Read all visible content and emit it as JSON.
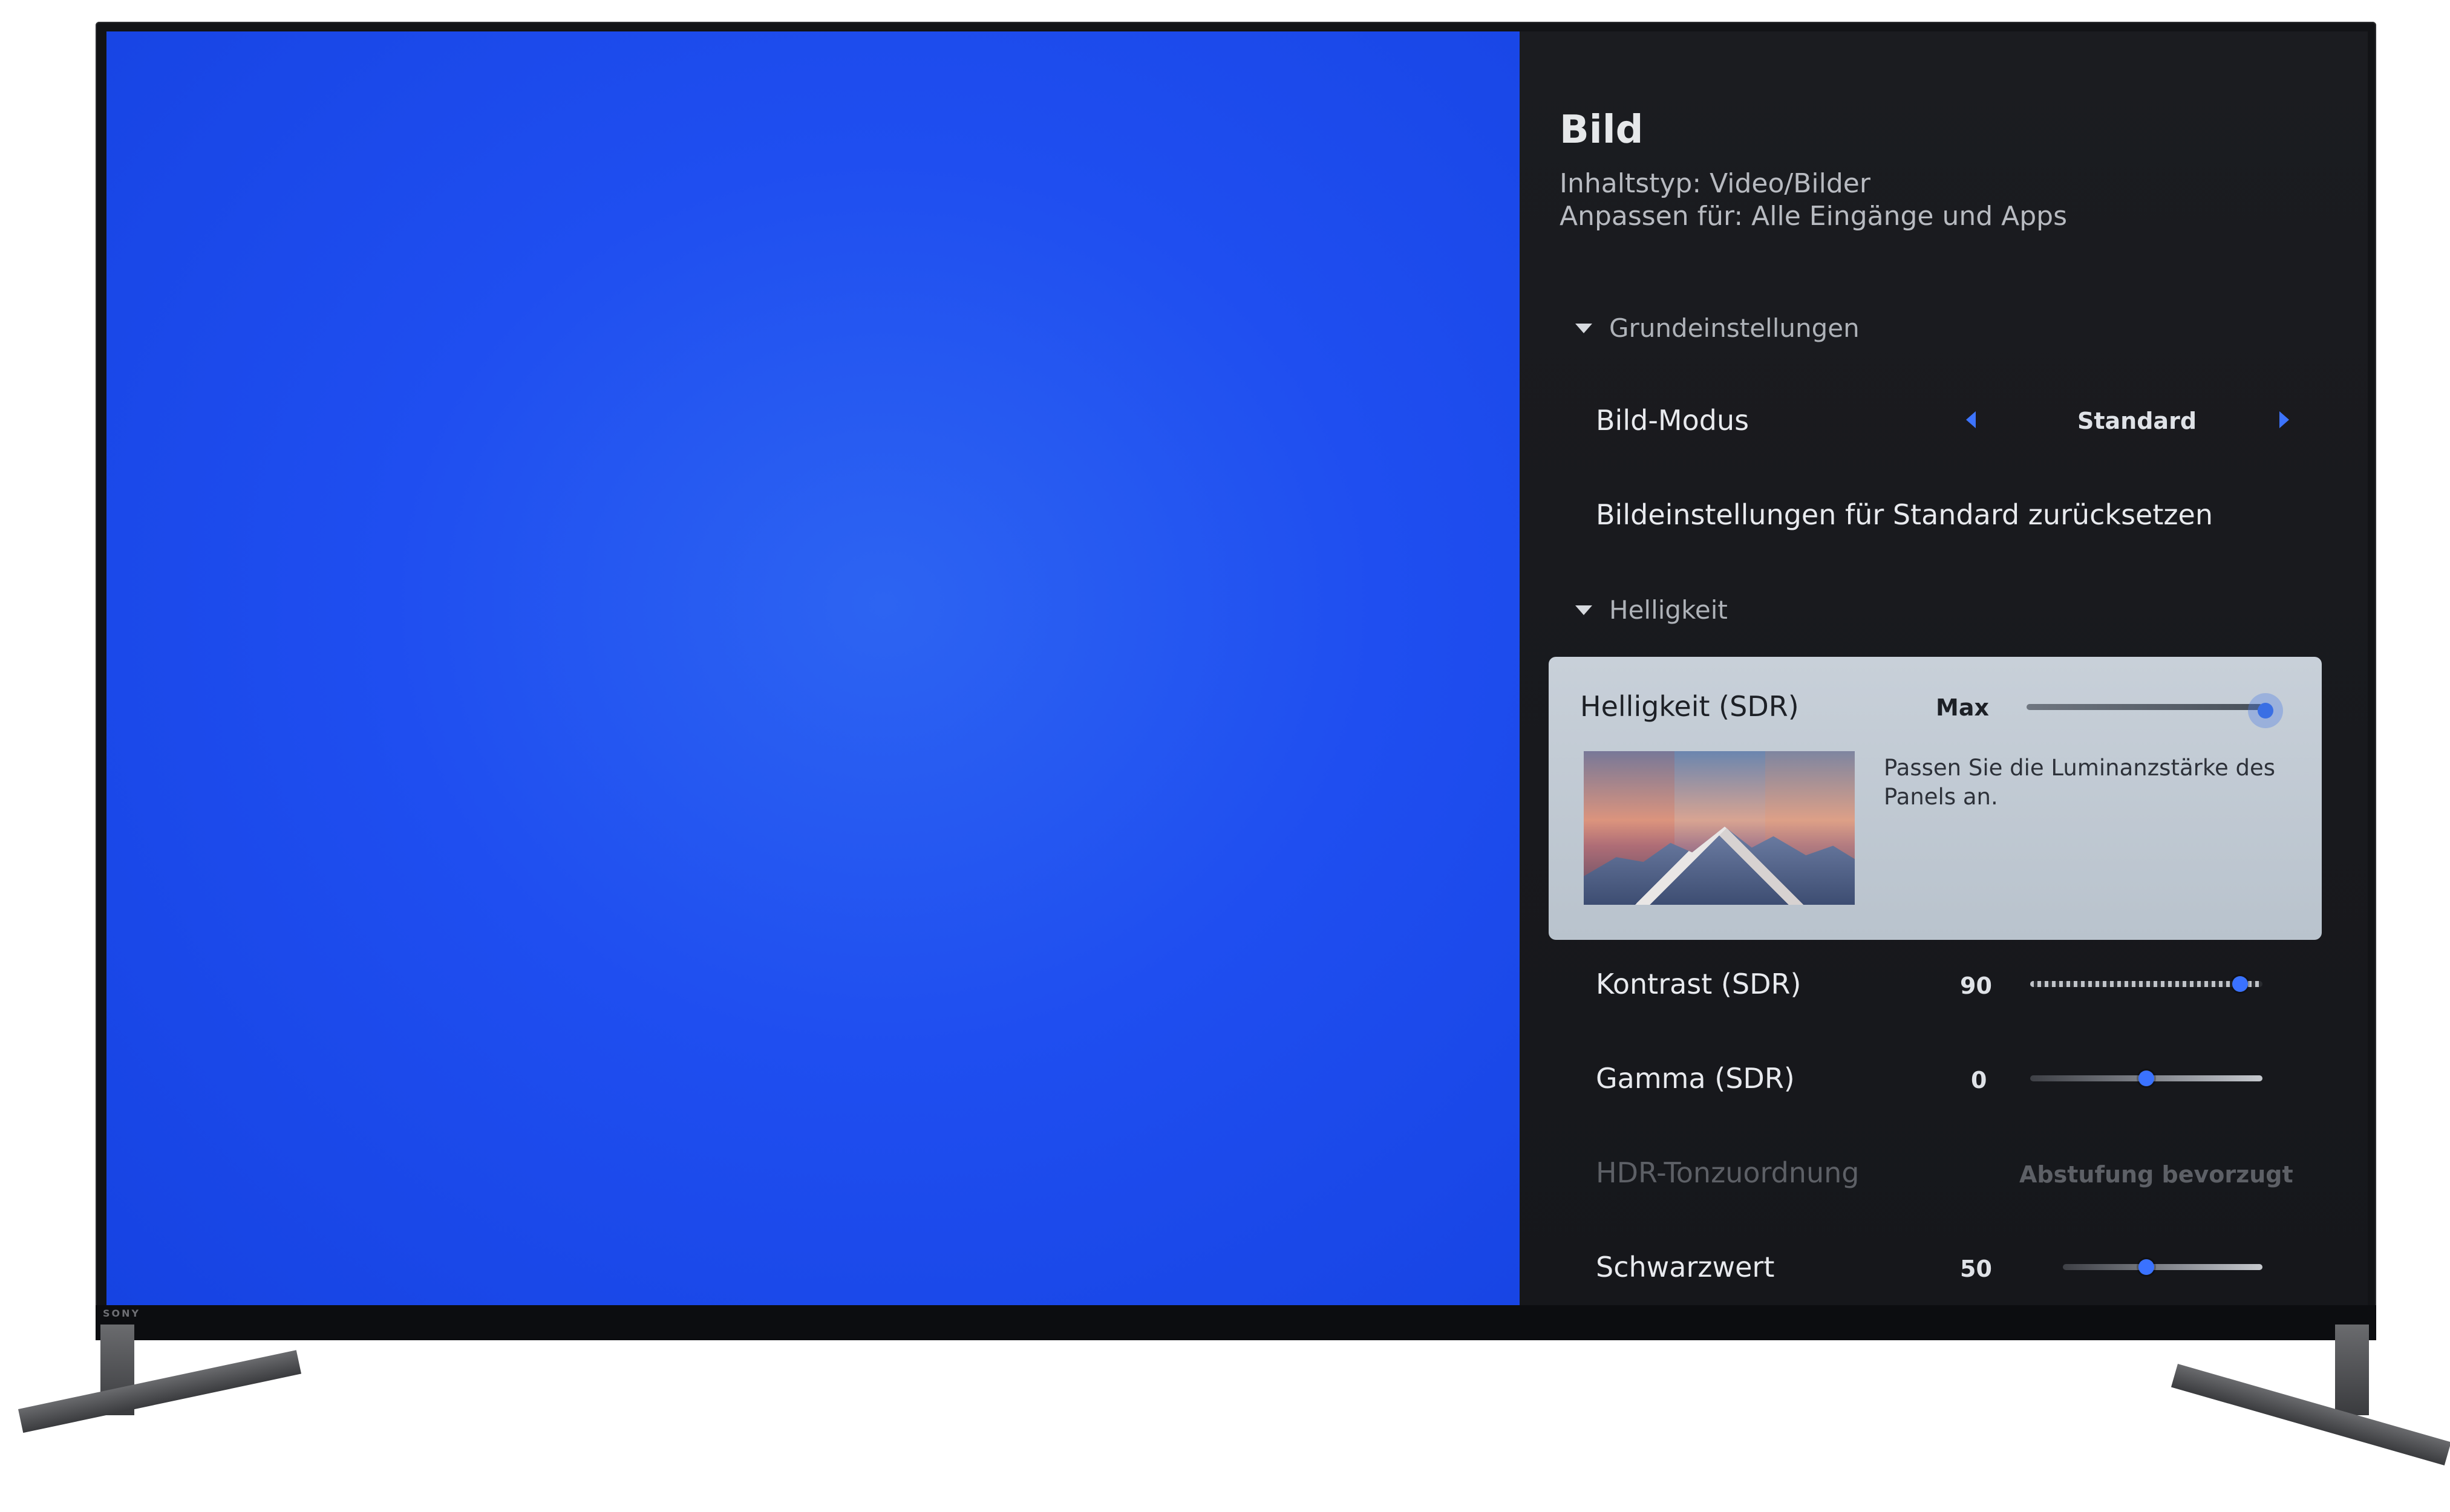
{
  "brand": "SONY",
  "menu": {
    "title": "Bild",
    "subtitle_lines": [
      "Inhaltstyp: Video/Bilder",
      "Anpassen für: Alle Eingänge und Apps"
    ],
    "section_basic": "Grundeinstellungen",
    "picture_mode": {
      "label": "Bild-Modus",
      "value": "Standard"
    },
    "reset_label": "Bildeinstellungen für Standard zurücksetzen",
    "section_brightness": "Helligkeit",
    "brightness_card": {
      "label": "Helligkeit (SDR)",
      "value": "Max",
      "level": 1.0,
      "description": "Passen Sie die Luminanzstärke des Panels an."
    },
    "contrast": {
      "label": "Kontrast (SDR)",
      "value": "90",
      "level": 0.9
    },
    "gamma": {
      "label": "Gamma (SDR)",
      "value": "0",
      "level": 0.5
    },
    "hdr_tone": {
      "label": "HDR-Tonzuordnung",
      "value": "Abstufung bevorzugt"
    },
    "black_level": {
      "label": "Schwarzwert",
      "value": "50",
      "level": 0.5
    }
  },
  "colors": {
    "screen_blue": "#1f4ef0",
    "accent_blue": "#3a72ff",
    "panel_bg": "#1b1c20",
    "card_bg": "#c8d0d9"
  }
}
